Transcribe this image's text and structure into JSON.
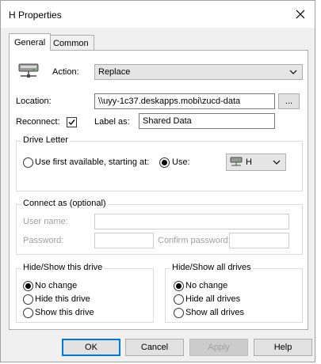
{
  "window": {
    "title": "H Properties"
  },
  "tabs": [
    {
      "label": "General"
    },
    {
      "label": "Common"
    }
  ],
  "general": {
    "action_label": "Action:",
    "action_value": "Replace",
    "location_label": "Location:",
    "location_value": "\\\\uyy-1c37.deskapps.mobi\\zucd-data",
    "browse_label": "...",
    "reconnect_label": "Reconnect:",
    "reconnect_checked": true,
    "label_as_label": "Label as:",
    "label_as_value": "Shared Data"
  },
  "drive_letter": {
    "title": "Drive Letter",
    "option_first_available": "Use first available, starting at:",
    "option_use": "Use:",
    "selected": "use",
    "drive_value": "H"
  },
  "connect_as": {
    "title": "Connect as (optional)",
    "user_name_label": "User name:",
    "password_label": "Password:",
    "confirm_password_label": "Confirm password:"
  },
  "hide_show_drive": {
    "title": "Hide/Show this drive",
    "options": [
      "No change",
      "Hide this drive",
      "Show this drive"
    ],
    "selected": "No change"
  },
  "hide_show_all": {
    "title": "Hide/Show all drives",
    "options": [
      "No change",
      "Hide all drives",
      "Show all drives"
    ],
    "selected": "No change"
  },
  "buttons": {
    "ok": "OK",
    "cancel": "Cancel",
    "apply": "Apply",
    "help": "Help"
  },
  "colors": {
    "accent": "#0078d7",
    "panel": "#ffffff",
    "window_bg": "#f0f0f0"
  }
}
